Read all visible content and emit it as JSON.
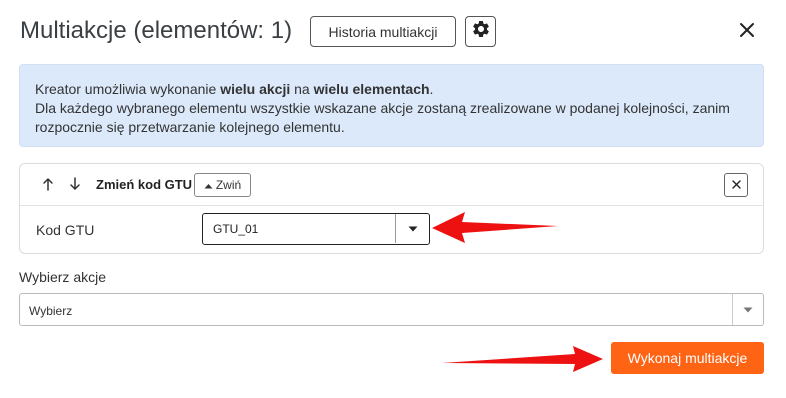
{
  "header": {
    "title": "Multiakcje (elementów: 1)",
    "history_button": "Historia multiakcji",
    "settings_icon": "gear-icon",
    "close_icon": "close-icon"
  },
  "info": {
    "line1_prefix": "Kreator umożliwia wykonanie ",
    "line1_bold1": "wielu akcji",
    "line1_mid": " na ",
    "line1_bold2": "wielu elementach",
    "line1_suffix": ".",
    "line2": "Dla każdego wybranego elementu wszystkie wskazane akcje zostaną zrealizowane w podanej kolejności, zanim rozpocznie się przetwarzanie kolejnego elementu."
  },
  "action_card": {
    "move_up_icon": "arrow-up-icon",
    "move_down_icon": "arrow-down-icon",
    "title": "Zmień kod GTU",
    "collapse_label": "Zwiń",
    "remove_icon": "close-icon",
    "field_label": "Kod GTU",
    "field_value": "GTU_01"
  },
  "choose_action": {
    "label": "Wybierz akcje",
    "placeholder": "Wybierz"
  },
  "footer": {
    "run_button": "Wykonaj multiakcje"
  },
  "colors": {
    "accent": "#ff6314",
    "info_background": "#dbe9fa",
    "annotation_arrow": "#ee1111"
  }
}
